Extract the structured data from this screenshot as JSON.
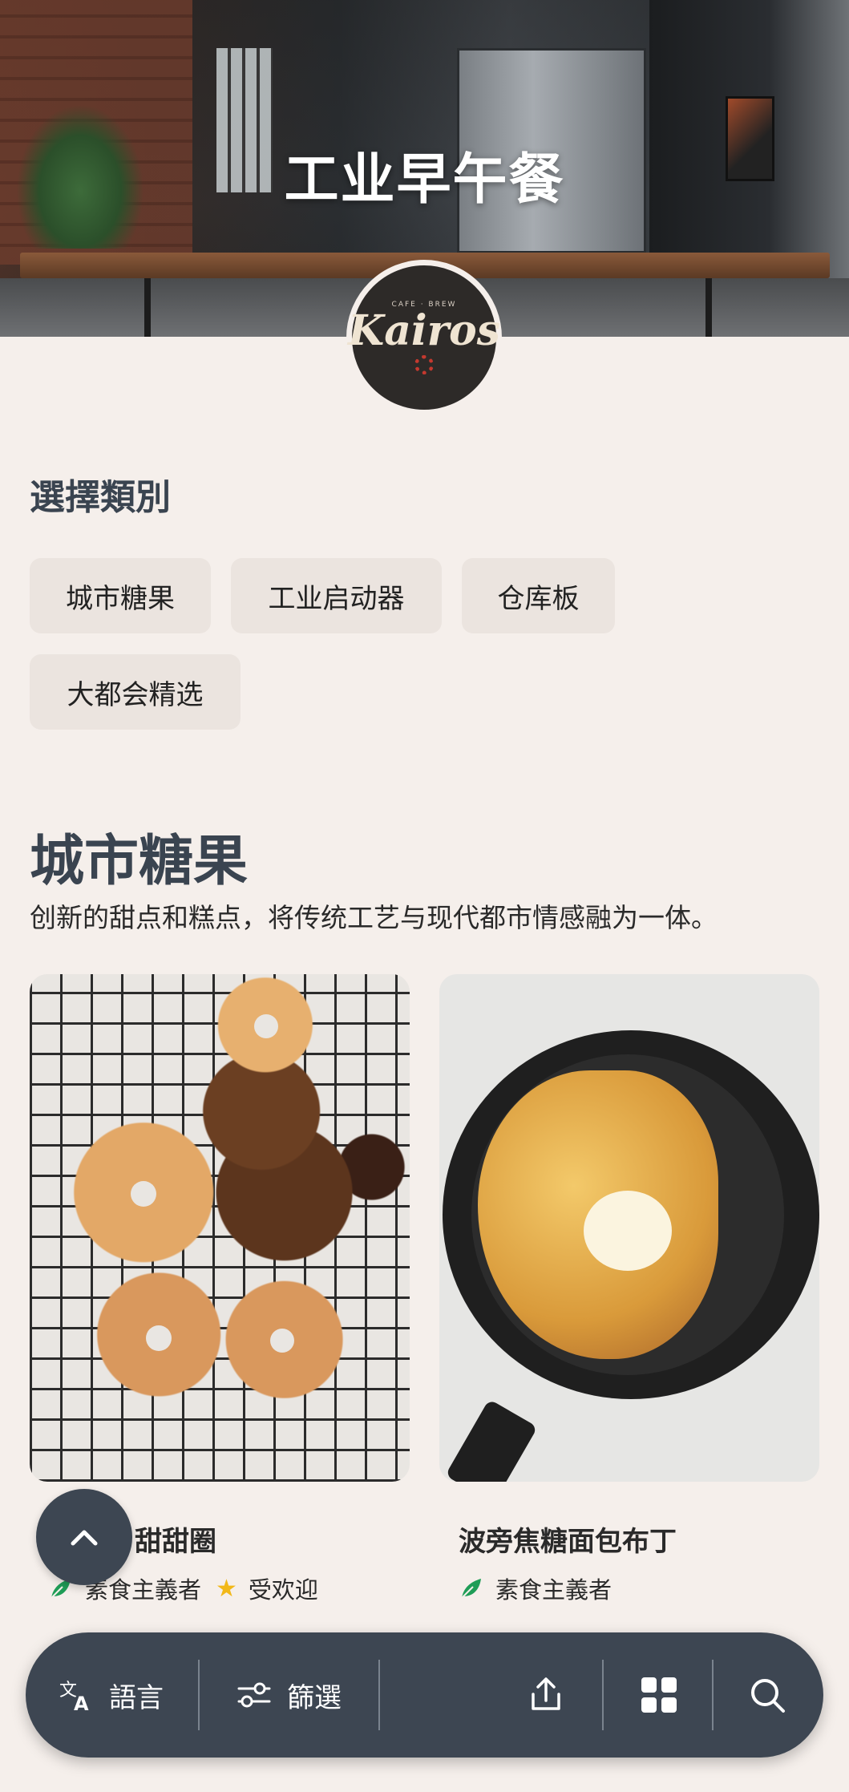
{
  "hero": {
    "title": "工业早午餐"
  },
  "logo": {
    "top_text": "CAFE · BREW",
    "brand": "Kairos"
  },
  "categories": {
    "heading": "選擇類別",
    "chips": [
      "城市糖果",
      "工业启动器",
      "仓库板",
      "大都会精选"
    ]
  },
  "section": {
    "title": "城市糖果",
    "description": "创新的甜点和糕点，将传统工艺与现代都市情感融为一体。"
  },
  "products": [
    {
      "name": "甜甜圈",
      "tags": [
        {
          "icon": "vegan-leaf-icon",
          "label": "素食主義者"
        },
        {
          "icon": "star-icon",
          "label": "受欢迎"
        }
      ]
    },
    {
      "name": "波旁焦糖面包布丁",
      "tags": [
        {
          "icon": "vegan-leaf-icon",
          "label": "素食主義者"
        }
      ]
    }
  ],
  "bottom_bar": {
    "language_label": "語言",
    "filter_label": "篩選",
    "icons": [
      "translate-icon",
      "filter-icon",
      "share-icon",
      "grid-icon",
      "search-icon"
    ]
  },
  "colors": {
    "background": "#f5efeb",
    "heading": "#3a4450",
    "chip_bg": "#ebe4df",
    "bar_bg": "#3d4652",
    "vegan_green": "#1f9d57",
    "star": "#f2b818"
  }
}
